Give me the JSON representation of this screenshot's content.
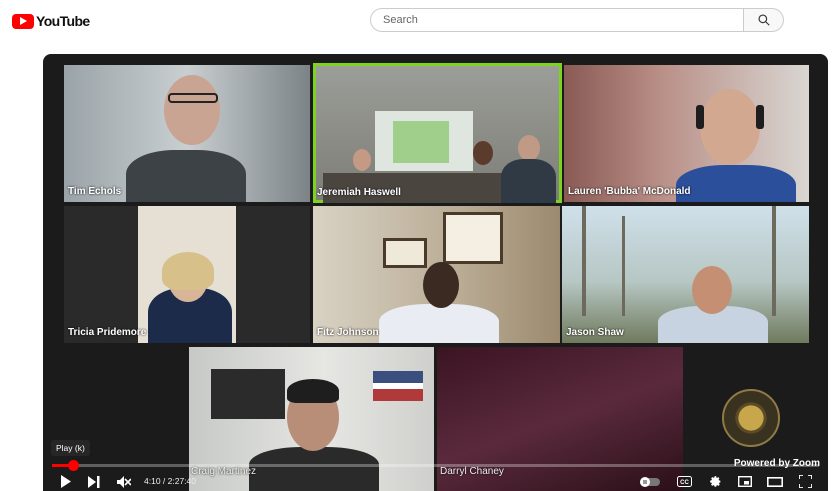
{
  "header": {
    "logo_text": "YouTube",
    "search_placeholder": "Search"
  },
  "meeting": {
    "participants": [
      {
        "name": "Tim Echols",
        "active": false
      },
      {
        "name": "Jeremiah Haswell",
        "active": true
      },
      {
        "name": "Lauren 'Bubba' McDonald",
        "active": false
      },
      {
        "name": "Tricia Pridemore",
        "active": false
      },
      {
        "name": "Fitz Johnson",
        "active": false
      },
      {
        "name": "Jason Shaw",
        "active": false
      },
      {
        "name": "Craig Martinez",
        "active": false
      },
      {
        "name": "Darryl Chaney",
        "active": false
      }
    ],
    "branding": "Powered by Zoom"
  },
  "player": {
    "tooltip": "Play (k)",
    "time_display": "4:10 / 2:27:40",
    "progress_fraction": 0.028,
    "accent_color": "#ff0000"
  },
  "icons": {
    "search": "search-icon",
    "play": "play-icon",
    "next": "next-icon",
    "mute": "muted-volume-icon",
    "autoplay": "autoplay-toggle-icon",
    "cc": "captions-icon",
    "settings": "gear-icon",
    "miniplayer": "miniplayer-icon",
    "theater": "theater-mode-icon",
    "fullscreen": "fullscreen-icon"
  }
}
